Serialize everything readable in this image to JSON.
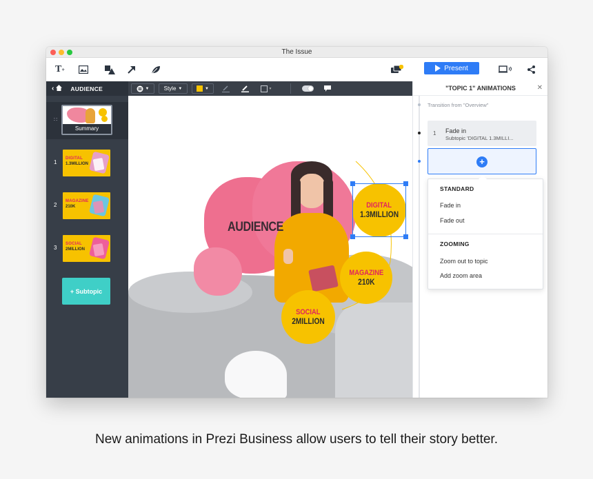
{
  "window": {
    "title": "The Issue"
  },
  "toolbar": {
    "icons": [
      "text-icon",
      "image-icon",
      "shapes-icon",
      "arrow-icon",
      "leaf-icon"
    ],
    "present_label": "Present"
  },
  "sidebar": {
    "topic_label": "AUDIENCE",
    "summary_label": "Summary",
    "slides": [
      {
        "num": "1",
        "line1": "DIGITAL",
        "line2": "1.3MILLION"
      },
      {
        "num": "2",
        "line1": "MAGAZINE",
        "line2": "210K"
      },
      {
        "num": "3",
        "line1": "SOCIAL",
        "line2": "2MILLION"
      }
    ],
    "subtopic_label": "+ Subtopic"
  },
  "canvas_bar": {
    "style_label": "Style"
  },
  "canvas": {
    "title": "AUDIENCE",
    "circles": [
      {
        "line1": "DIGITAL",
        "line2": "1.3MILLION"
      },
      {
        "line1": "MAGAZINE",
        "line2": "210K"
      },
      {
        "line1": "SOCIAL",
        "line2": "2MILLION"
      }
    ]
  },
  "panel": {
    "title": "\"TOPIC 1\" ANIMATIONS",
    "transition_text": "Transition from \"Overview\"",
    "animation": {
      "num": "1",
      "title": "Fade in",
      "subtitle": "Subtopic 'DIGITAL 1.3MILLI..."
    },
    "dropdown": {
      "standard_heading": "STANDARD",
      "standard_items": [
        "Fade in",
        "Fade out"
      ],
      "zooming_heading": "ZOOMING",
      "zooming_items": [
        "Zoom out to topic",
        "Add zoom area"
      ]
    }
  },
  "caption": "New animations in Prezi Business allow users to tell their story better.",
  "colors": {
    "accent": "#2e7cf6",
    "yellow": "#f7c200",
    "pink": "#e0245e",
    "teal": "#3fcfc7",
    "sidebar": "#373e48"
  }
}
